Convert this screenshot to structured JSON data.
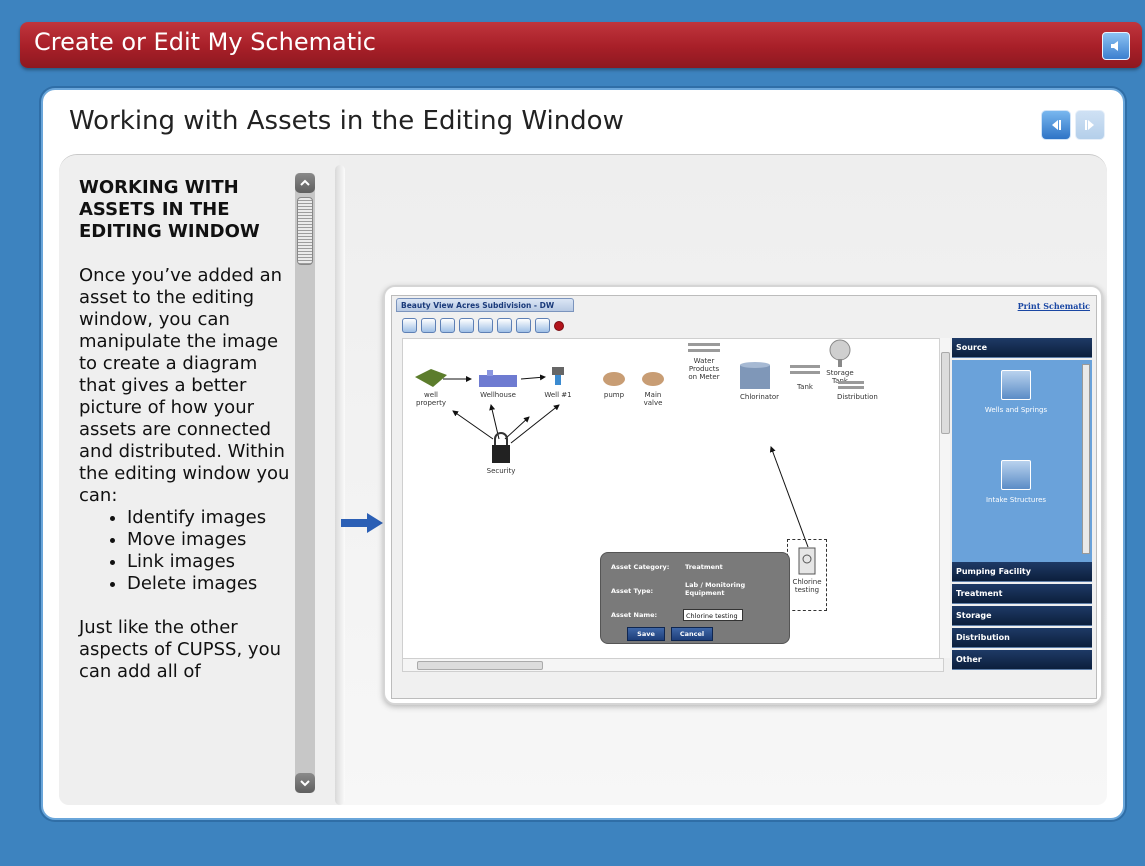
{
  "header": {
    "title": "Create or Edit My Schematic",
    "sound_icon": "speaker-icon"
  },
  "panel": {
    "title": "Working with Assets in the Editing Window"
  },
  "sidebar": {
    "heading": "WORKING WITH ASSETS IN THE EDITING WINDOW",
    "intro": "Once you’ve added an asset to the editing window, you can manipulate the image to create a diagram that gives a better picture of how your assets are connected and distributed. Within the editing window you can:",
    "bullets": [
      "Identify images",
      "Move images",
      "Link images",
      "Delete images"
    ],
    "outro": "Just like the other aspects of CUPSS, you can add all of"
  },
  "screenshot": {
    "tab_label": "Beauty View Acres Subdivision - DW",
    "print_link": "Print Schematic",
    "nodes": [
      "well property",
      "Wellhouse",
      "Well #1",
      "pump",
      "Main valve",
      "Water Products on Meter",
      "Chlorinator",
      "Tank",
      "Storage Tank",
      "Distribution",
      "Security",
      "Chlorine testing"
    ],
    "categories": [
      "Source",
      "Pumping Facility",
      "Treatment",
      "Storage",
      "Distribution",
      "Other"
    ],
    "source_items": [
      "Wells and Springs",
      "Intake Structures"
    ],
    "dialog": {
      "category_label": "Asset Category:",
      "category_value": "Treatment",
      "type_label": "Asset Type:",
      "type_value": "Lab / Monitoring Equipment",
      "name_label": "Asset Name:",
      "name_value": "Chlorine testing",
      "save": "Save",
      "cancel": "Cancel"
    }
  }
}
